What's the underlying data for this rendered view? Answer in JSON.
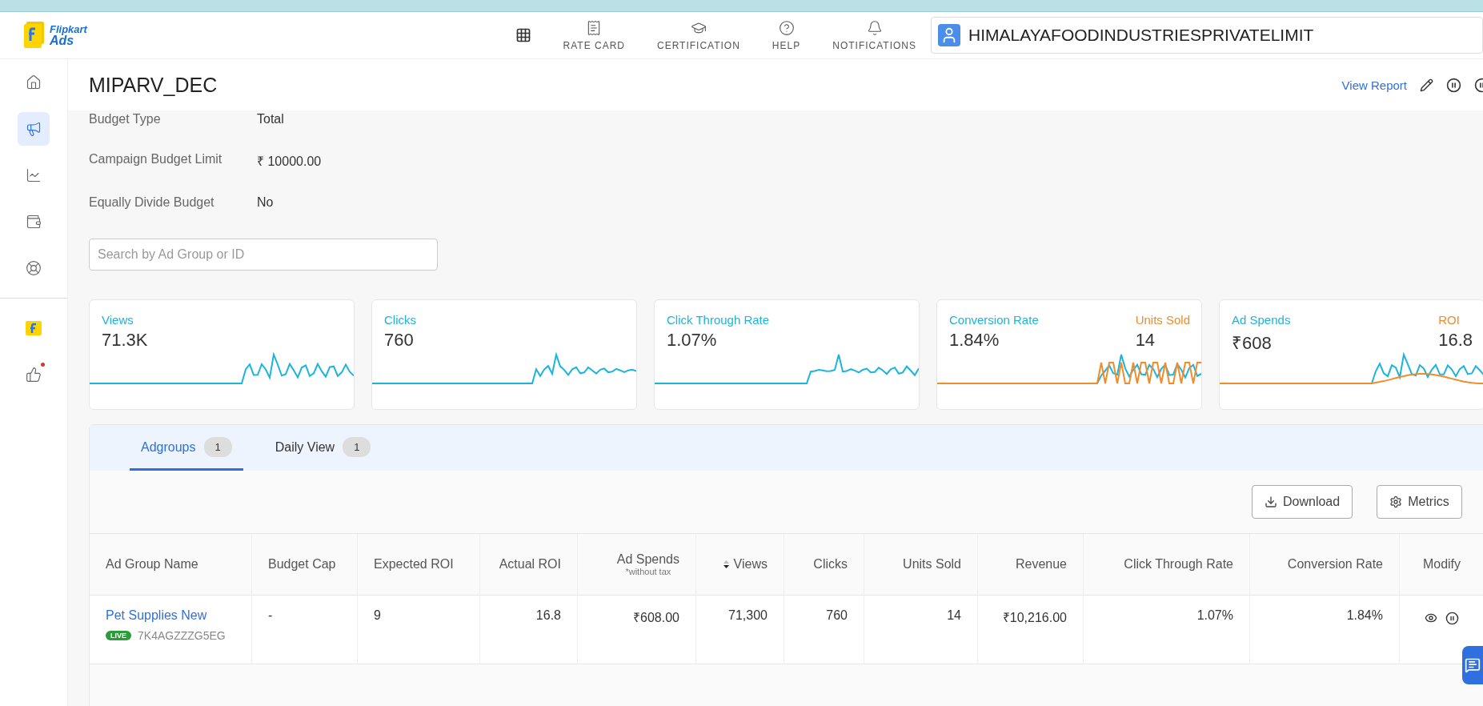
{
  "header": {
    "logo": {
      "line1": "Flipkart",
      "line2": "Ads"
    },
    "nav": [
      {
        "kind": "grid"
      },
      {
        "kind": "ratecard",
        "label": "RATE CARD"
      },
      {
        "kind": "certification",
        "label": "CERTIFICATION"
      },
      {
        "kind": "help",
        "label": "HELP"
      },
      {
        "kind": "notifications",
        "label": "NOTIFICATIONS"
      }
    ],
    "account": "HIMALAYAFOODINDUSTRIESPRIVATELIMIT"
  },
  "sidebar": {
    "items": [
      {
        "kind": "home",
        "selected": false
      },
      {
        "kind": "campaign",
        "selected": true
      },
      {
        "kind": "reports",
        "selected": false
      },
      {
        "kind": "wallet",
        "selected": false
      },
      {
        "kind": "support",
        "selected": false
      }
    ],
    "bottom_items": [
      {
        "kind": "flipkart"
      },
      {
        "kind": "feedback",
        "dot": true
      }
    ]
  },
  "page": {
    "title": "MIPARV_DEC",
    "view_report": "View Report"
  },
  "details": [
    {
      "label": "Budget Type",
      "value": "Total"
    },
    {
      "label": "Campaign Budget Limit",
      "value": "₹  10000.00"
    },
    {
      "label": "Equally Divide Budget",
      "value": "No"
    }
  ],
  "search": {
    "placeholder": "Search by Ad Group or ID"
  },
  "cards": [
    {
      "metrics": [
        {
          "label": "Views",
          "value": "71.3K",
          "color": "#1cb4dc"
        }
      ]
    },
    {
      "metrics": [
        {
          "label": "Clicks",
          "value": "760",
          "color": "#1cb4dc"
        }
      ]
    },
    {
      "metrics": [
        {
          "label": "Click Through Rate",
          "value": "1.07%",
          "color": "#1cb4dc"
        }
      ]
    },
    {
      "metrics": [
        {
          "label": "Conversion Rate",
          "value": "1.84%",
          "color": "#1cb4dc"
        },
        {
          "label": "Units Sold",
          "value": "14",
          "color": "#f08c2a"
        }
      ]
    },
    {
      "metrics": [
        {
          "label": "Ad Spends",
          "value": "₹608",
          "color": "#1cb4dc"
        },
        {
          "label": "ROI",
          "value": "16.8",
          "color": "#f08c2a"
        }
      ]
    }
  ],
  "tabs": [
    {
      "label": "Adgroups",
      "count": "1",
      "selected": true
    },
    {
      "label": "Daily View",
      "count": "1",
      "selected": false
    }
  ],
  "toolbar": [
    {
      "kind": "download",
      "label": "Download"
    },
    {
      "kind": "metrics",
      "label": "Metrics"
    }
  ],
  "table": {
    "columns": [
      {
        "label": "Ad Group Name"
      },
      {
        "label": "Budget Cap"
      },
      {
        "label": "Expected ROI"
      },
      {
        "label": "Actual ROI"
      },
      {
        "label": "Ad Spends",
        "note": "*without tax"
      },
      {
        "label": "Views",
        "sort": true
      },
      {
        "label": "Clicks"
      },
      {
        "label": "Units Sold"
      },
      {
        "label": "Revenue"
      },
      {
        "label": "Click Through Rate"
      },
      {
        "label": "Conversion Rate"
      },
      {
        "label": "Modify"
      }
    ],
    "rows": [
      {
        "status": "LIVE",
        "id": "7K4AGZZZG5EG",
        "cells": [
          "Pet Supplies New",
          "-",
          "9",
          "16.8",
          "₹608.00",
          "71,300",
          "760",
          "14",
          "₹10,216.00",
          "1.07%",
          "1.84%"
        ]
      }
    ]
  }
}
